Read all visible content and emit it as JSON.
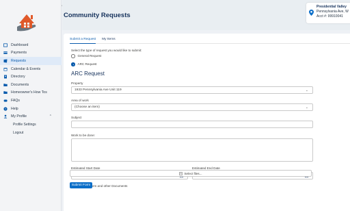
{
  "sidebar": {
    "logo_icon": "house-in-hand-icon",
    "collapse_icon": "chevron-left-icon",
    "items": [
      {
        "label": "Dashboard",
        "icon": "dashboard-icon",
        "active": false
      },
      {
        "label": "Payments",
        "icon": "payments-icon",
        "active": false
      },
      {
        "label": "Requests",
        "icon": "requests-icon",
        "active": true
      },
      {
        "label": "Calendar & Events",
        "icon": "calendar-icon",
        "active": false
      },
      {
        "label": "Directory",
        "icon": "directory-icon",
        "active": false
      },
      {
        "label": "Documents",
        "icon": "folder-icon",
        "active": false
      },
      {
        "label": "Homeowner's How Tos",
        "icon": "folder-icon",
        "active": false
      },
      {
        "label": "FAQs",
        "icon": "faq-icon",
        "active": false
      },
      {
        "label": "Help",
        "icon": "help-icon",
        "active": false
      },
      {
        "label": "My Profile",
        "icon": "person-icon",
        "active": false
      }
    ],
    "sub_items": [
      {
        "label": "Profile Settings"
      },
      {
        "label": "Logout"
      }
    ]
  },
  "header": {
    "title": "Community Requests",
    "account": {
      "name": "Presidential Valley",
      "address": "Pennsylvania Ave, W",
      "acct": "Acct #: 99910041"
    }
  },
  "tabs": [
    {
      "label": "Submit a Request",
      "active": true
    },
    {
      "label": "My Items",
      "active": false
    }
  ],
  "form": {
    "type_prompt": "Select the type of request you would like to submit:",
    "request_types": [
      {
        "label": "General Request",
        "checked": false
      },
      {
        "label": "ARC Request",
        "checked": true
      }
    ],
    "section_title": "ARC Request",
    "property_label": "Property",
    "property_value": "1933 Pennsylvania Ave Unit 119",
    "area_label": "Area of work",
    "area_value": "(Choose an item)",
    "subject_label": "Subject",
    "subject_value": "",
    "work_label": "Work to be done:",
    "work_value": "",
    "start_label": "Estimated Start Date",
    "end_label": "Estimated End Date",
    "upload_label": "Upload ARC Form and other Documents",
    "upload_button": "Select files...",
    "submit_button": "Submit Form"
  },
  "colors": {
    "accent": "#0b5cad",
    "button": "#0b6ec8",
    "header_bg": "#e9eef2",
    "active_nav_bg": "#dfeaf8"
  }
}
